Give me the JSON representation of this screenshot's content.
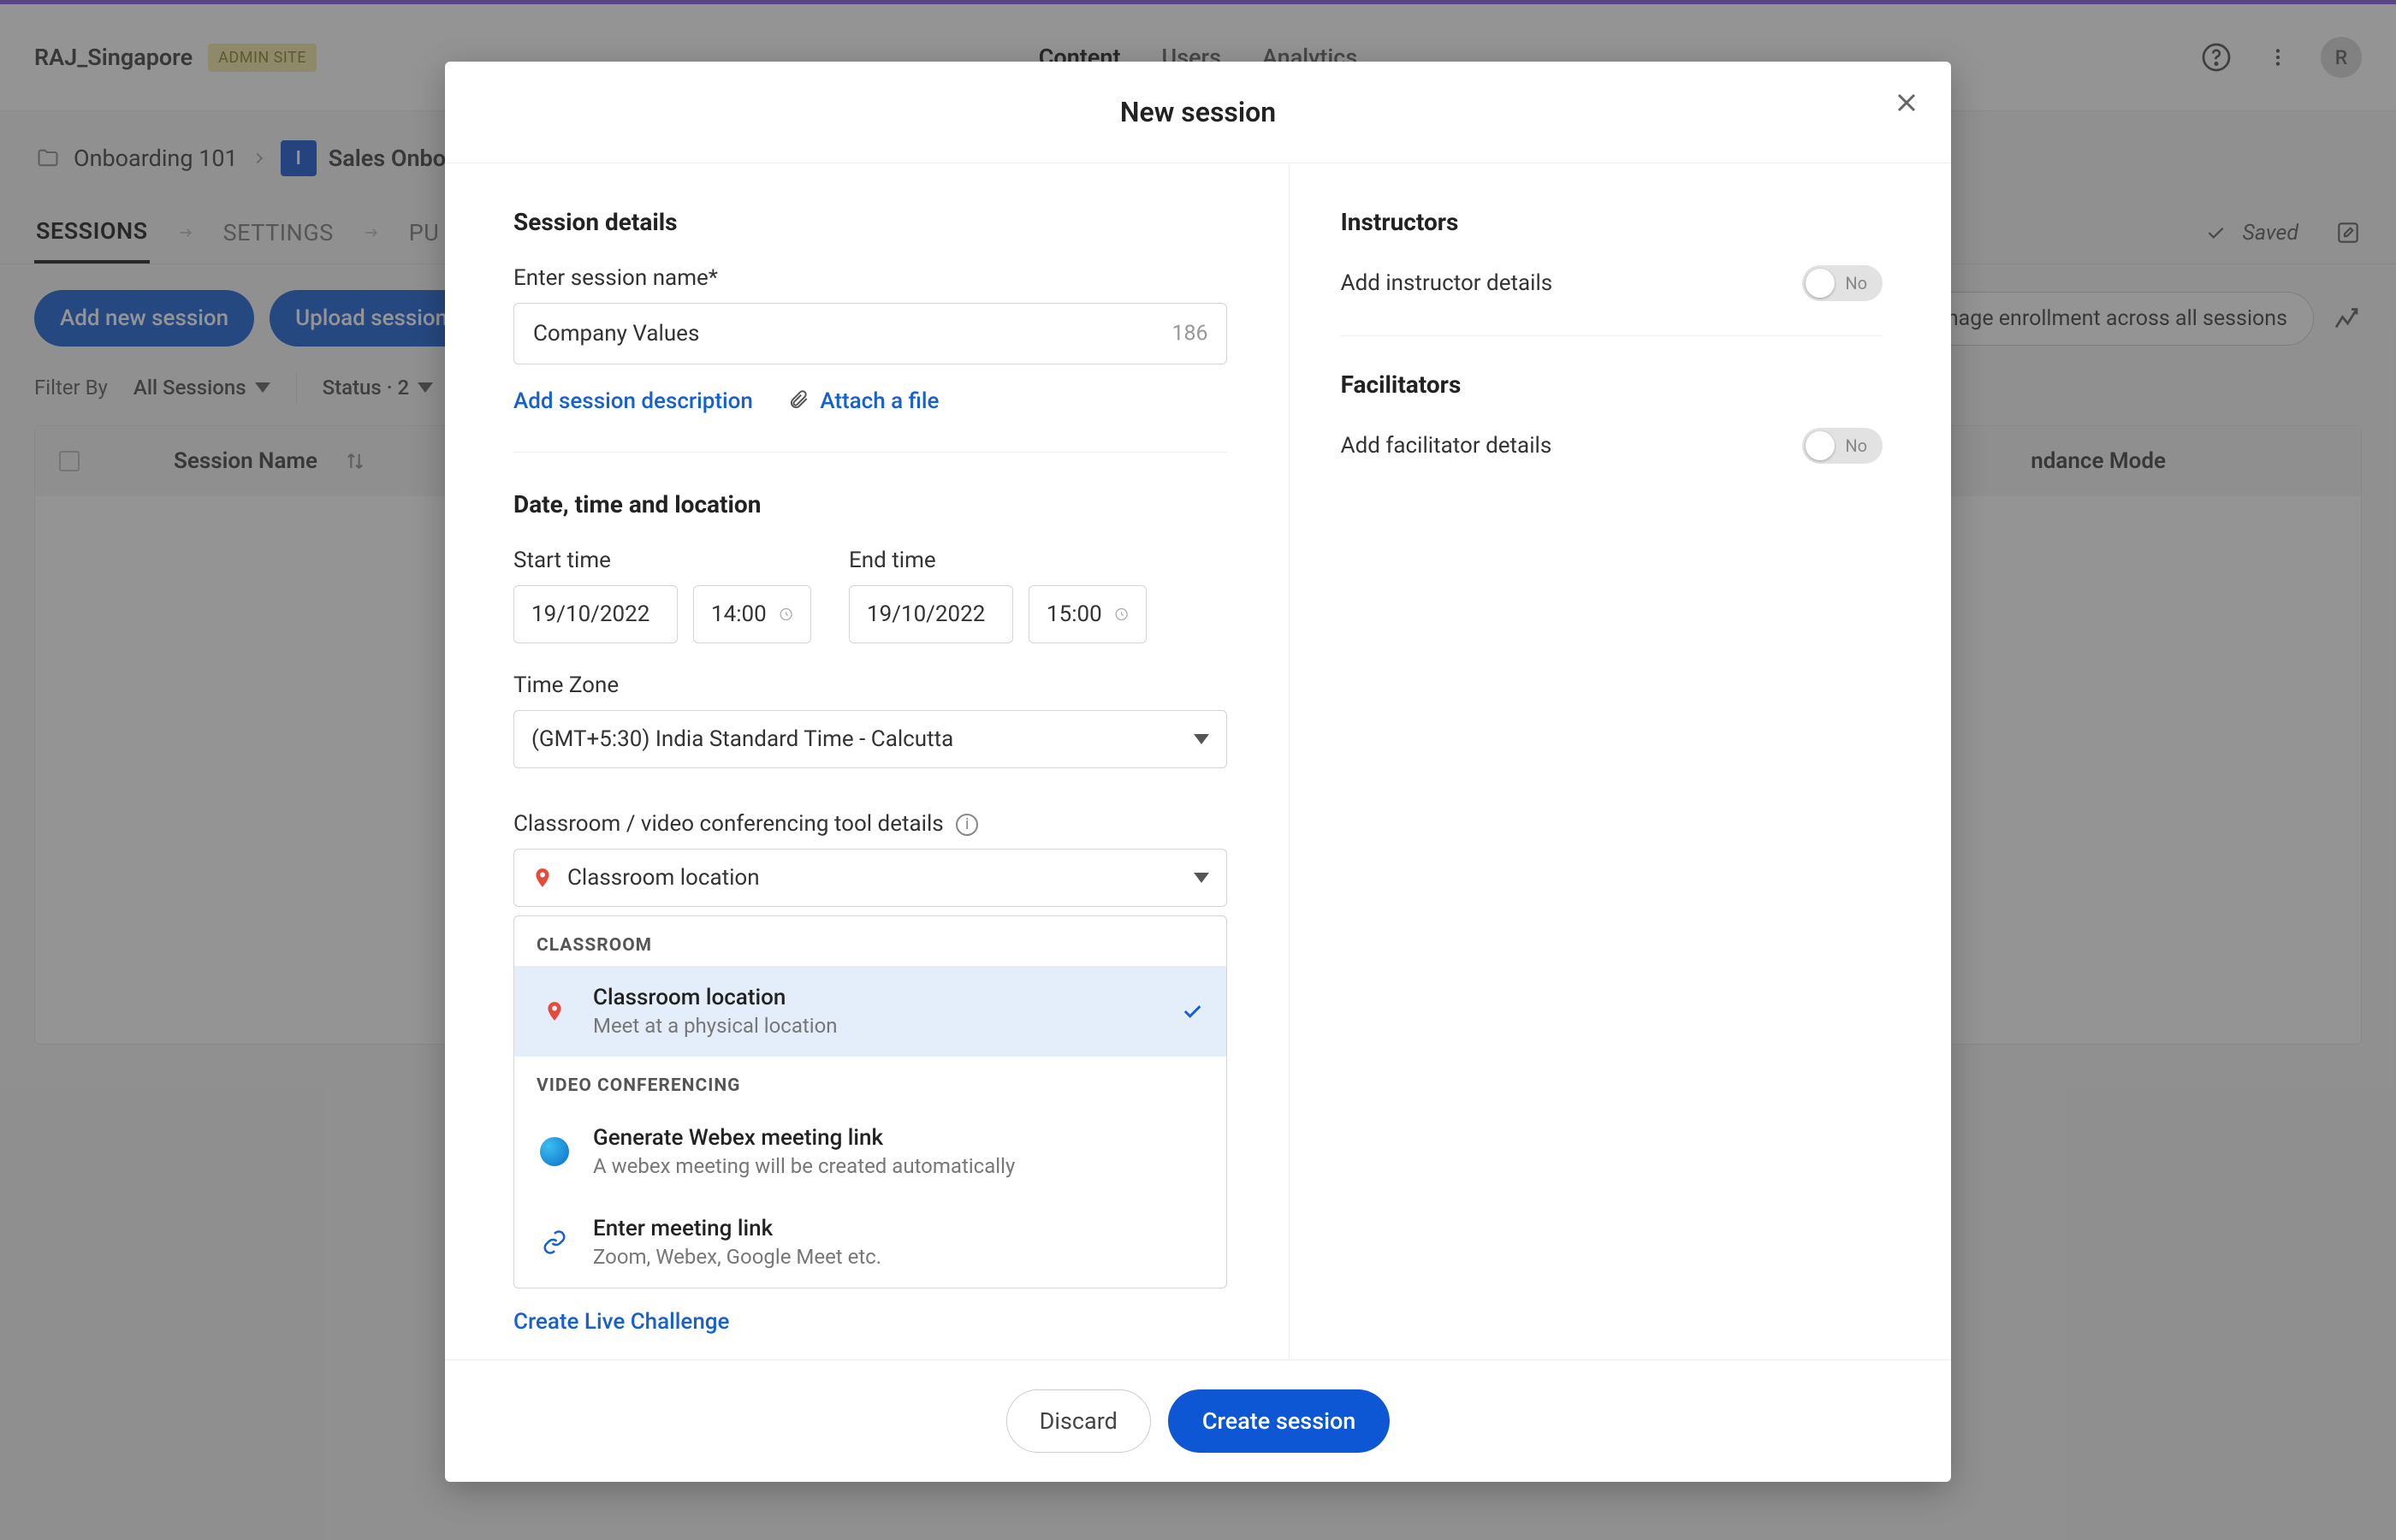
{
  "topnav": {
    "brand": "RAJ_Singapore",
    "admin_badge": "ADMIN SITE",
    "items": {
      "content": "Content",
      "users": "Users",
      "analytics": "Analytics"
    },
    "avatar_letter": "R"
  },
  "breadcrumb": {
    "folder": "Onboarding 101",
    "chip_letter": "I",
    "title": "Sales Onbo"
  },
  "tabs": {
    "sessions": "SESSIONS",
    "settings": "SETTINGS",
    "publish": "PU",
    "saved": "Saved"
  },
  "actions": {
    "add_session": "Add new session",
    "upload_sessions": "Upload sessions",
    "manage_enrollment": "Manage enrollment across all sessions"
  },
  "filters": {
    "filter_by": "Filter By",
    "all_sessions": "All Sessions",
    "status": "Status · 2"
  },
  "table": {
    "col_session_name": "Session Name",
    "col_attendance": "ndance Mode"
  },
  "modal": {
    "title": "New session",
    "session_details_h": "Session details",
    "name_label": "Enter session name*",
    "name_value": "Company Values",
    "name_remaining": "186",
    "add_description": "Add session description",
    "attach_file": "Attach a file",
    "datetime_h": "Date, time and location",
    "start_label": "Start time",
    "end_label": "End time",
    "start_date": "19/10/2022",
    "start_time": "14:00",
    "end_date": "19/10/2022",
    "end_time": "15:00",
    "tz_label": "Time Zone",
    "tz_value": "(GMT+5:30) India Standard Time - Calcutta",
    "tool_label": "Classroom / video conferencing tool details",
    "tool_selected": "Classroom location",
    "dd": {
      "section1": "CLASSROOM",
      "opt1_title": "Classroom location",
      "opt1_sub": "Meet at a physical location",
      "section2": "VIDEO CONFERENCING",
      "opt2_title": "Generate Webex meeting link",
      "opt2_sub": "A webex meeting will be created automatically",
      "opt3_title": "Enter meeting link",
      "opt3_sub": "Zoom, Webex, Google Meet etc."
    },
    "create_live": "Create Live Challenge",
    "instructors_h": "Instructors",
    "add_instructor": "Add instructor details",
    "facilitators_h": "Facilitators",
    "add_facilitator": "Add facilitator details",
    "toggle_no": "No",
    "discard": "Discard",
    "create": "Create session"
  }
}
